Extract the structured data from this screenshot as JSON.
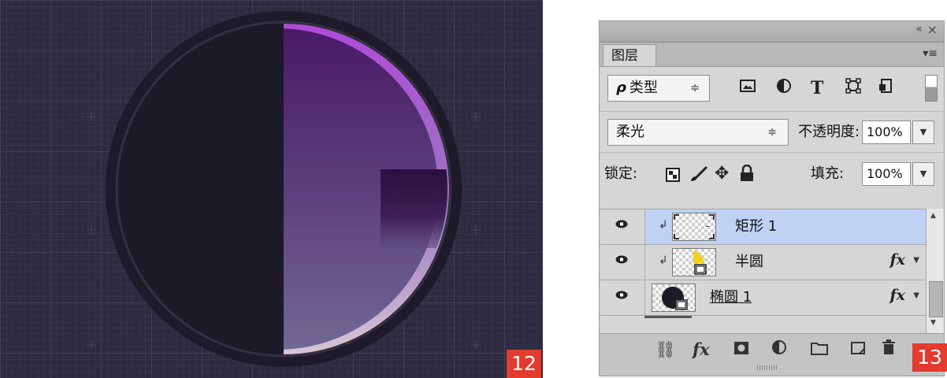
{
  "step_badges": {
    "left": "12",
    "right": "13"
  },
  "canvas": {
    "colors": {
      "background": "#2e2b40",
      "ring": "#1d1b28",
      "dark_half": "#1b1a26",
      "purple_top": "#4f1e69",
      "purple_bottom": "#6a5f8a",
      "rim": "#a84ad0"
    }
  },
  "panel": {
    "topbar": {
      "collapse_icon": "«",
      "close_icon": "×"
    },
    "tab": {
      "label": "图层",
      "menu_icon": "▾≡"
    },
    "filter": {
      "label": "类型",
      "search_icon": "ρ",
      "arrows": "≑",
      "type_icons": [
        "image-filter-icon",
        "adjustment-filter-icon",
        "text-filter-icon",
        "shape-filter-icon",
        "smart-object-filter-icon"
      ],
      "text_icon": "T"
    },
    "blend": {
      "mode": "柔光",
      "arrows": "≑",
      "opacity_label": "不透明度:",
      "opacity_value": "100%"
    },
    "lock": {
      "label": "锁定:",
      "fill_label": "填充:",
      "fill_value": "100%"
    },
    "layers": [
      {
        "name": "矩形 1",
        "selected": true,
        "clipped": true,
        "fx": false,
        "thumb": "rect-shape"
      },
      {
        "name": "半圆",
        "selected": false,
        "clipped": true,
        "fx": true,
        "thumb": "half-circle-shape"
      },
      {
        "name": "椭圆 1",
        "selected": false,
        "clipped": false,
        "fx": true,
        "thumb": "ellipse-shape"
      }
    ],
    "fx_label": "fx",
    "bottom_icons": [
      "link-icon",
      "fx-icon",
      "mask-icon",
      "adjustment-icon",
      "folder-icon",
      "new-layer-icon",
      "trash-icon"
    ]
  }
}
